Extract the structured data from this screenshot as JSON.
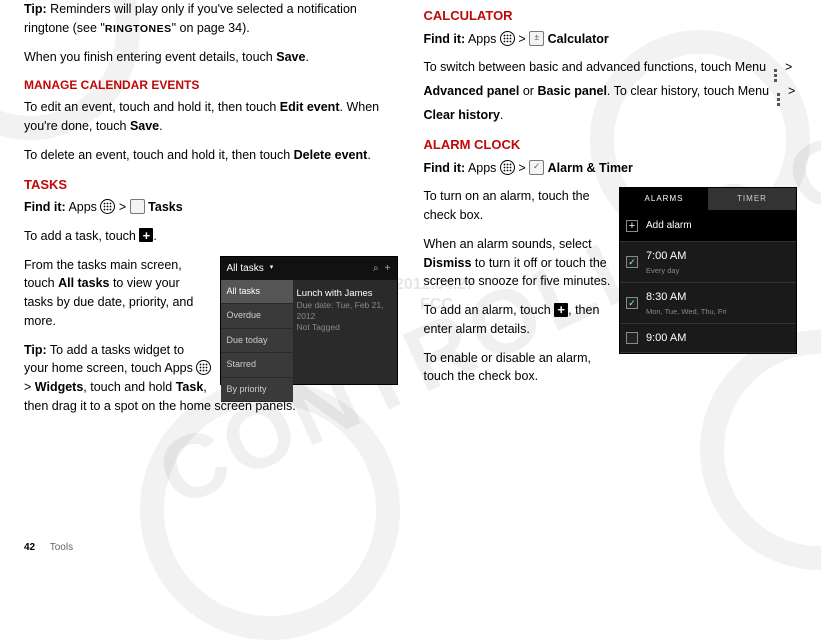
{
  "footer": {
    "page": "42",
    "section": "Tools"
  },
  "watermark": {
    "controlled": "CONTROLLED COPY",
    "date": "2012.04.27",
    "fcc": "FCC"
  },
  "left": {
    "tip1_a": "Tip:",
    "tip1_b": " Reminders will play only if you've selected a notification ringtone (see \"",
    "tip1_c": "RINGTONES",
    "tip1_d": "\" on page 34).",
    "save_a": "When you finish entering event details, touch ",
    "save_b": "Save",
    "save_c": ".",
    "h_manage": "MANAGE CALENDAR EVENTS",
    "edit_a": "To edit an event, touch and hold it, then touch ",
    "edit_b": "Edit event",
    "edit_c": ". When you're done, touch ",
    "edit_d": "Save",
    "edit_e": ".",
    "del_a": "To delete an event, touch and hold it, then touch ",
    "del_b": "Delete event",
    "del_c": ".",
    "h_tasks": "TASKS",
    "find_label": "Find it:",
    "find_apps": " Apps ",
    "gt": " > ",
    "find_tasks": " Tasks",
    "add_a": "To add a task, touch ",
    "add_b": ".",
    "main_a": "From the tasks main screen, touch ",
    "main_b": "All tasks",
    "main_c": " to view your tasks by due date, priority, and more.",
    "tip2_a": "Tip:",
    "tip2_b": " To add a tasks widget to your home screen, touch Apps ",
    "tip2_c": "Widgets",
    "tip2_d": ", touch and hold ",
    "tip2_e": "Task",
    "tip2_f": ", then drag it to a spot on the home screen panels.",
    "shot": {
      "header": "All tasks",
      "search_glyph": "⌕",
      "plus_glyph": "+",
      "menu": [
        "All tasks",
        "Overdue",
        "Due today",
        "Starred",
        "By priority"
      ],
      "item_title": "Lunch with James",
      "item_sub": "Due date: Tue, Feb 21, 2012",
      "item_tag": "Not Tagged"
    }
  },
  "right": {
    "h_calc": "CALCULATOR",
    "find_label": "Find it:",
    "find_apps": " Apps ",
    "gt": " > ",
    "find_calc": " Calculator",
    "calc_a": "To switch between basic and advanced functions, touch Menu ",
    "calc_b": "Advanced panel",
    "calc_c": " or ",
    "calc_d": "Basic panel",
    "calc_e": ". To clear history, touch Menu ",
    "calc_f": "Clear history",
    "calc_g": ".",
    "h_alarm": "ALARM CLOCK",
    "find_alarm": " Alarm & Timer",
    "al_on": "To turn on an alarm, touch the check box.",
    "al_snd_a": "When an alarm sounds, select ",
    "al_snd_b": "Dismiss",
    "al_snd_c": " to turn it off or touch the screen to snooze for five minutes.",
    "al_add_a": "To add an alarm, touch ",
    "al_add_b": ", then enter alarm details.",
    "al_en": "To enable or disable an alarm, touch the check box.",
    "shot": {
      "tab1": "ALARMS",
      "tab2": "TIMER",
      "add": "Add alarm",
      "rows": [
        {
          "time": "7:00 AM",
          "sub": "Every day",
          "on": true
        },
        {
          "time": "8:30 AM",
          "sub": "Mon, Tue, Wed, Thu, Fri",
          "on": true
        },
        {
          "time": "9:00 AM",
          "sub": "",
          "on": false
        }
      ]
    }
  }
}
